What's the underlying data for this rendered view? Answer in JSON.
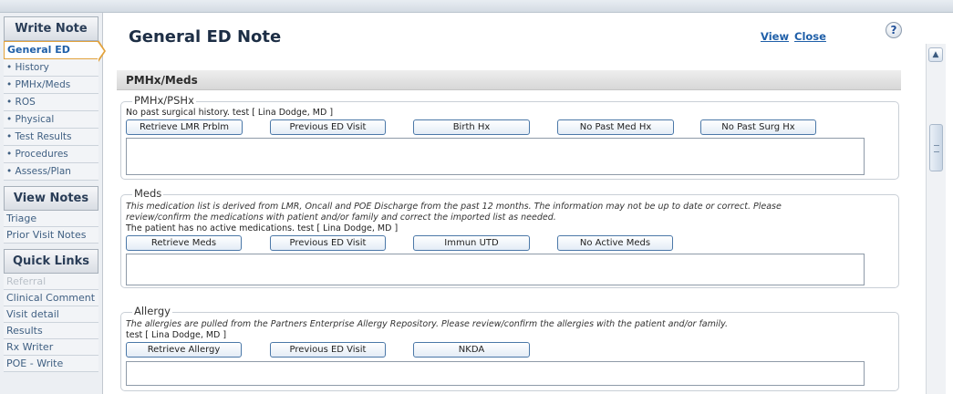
{
  "sidebar": {
    "write_note": {
      "heading": "Write Note",
      "active_item": "General ED",
      "items": [
        "History",
        "PMHx/Meds",
        "ROS",
        "Physical",
        "Test Results",
        "Procedures",
        "Assess/Plan"
      ]
    },
    "view_notes": {
      "heading": "View Notes",
      "items": [
        "Triage",
        "Prior Visit Notes"
      ]
    },
    "quick_links": {
      "heading": "Quick Links",
      "items": [
        "Referral",
        "Clinical Comment",
        "Visit detail",
        "Results",
        "Rx Writer",
        "POE - Write"
      ],
      "disabled_item": "Referral"
    }
  },
  "main": {
    "title": "General ED Note",
    "view_link": "View",
    "close_link": "Close",
    "help_icon": "?",
    "section_title": "PMHx/Meds",
    "pmhx": {
      "legend": "PMHx/PSHx",
      "info": "No past surgical history. test [ Lina Dodge, MD ]",
      "buttons": [
        "Retrieve LMR Prblm",
        "Previous ED Visit",
        "Birth Hx",
        "No Past Med Hx",
        "No Past Surg Hx"
      ]
    },
    "meds": {
      "legend": "Meds",
      "disclaimer_line1": "This medication list is derived from LMR, Oncall and POE Discharge from the past 12 months. The information may not be up to date or correct. Please",
      "disclaimer_line2": "review/confirm the medications with patient and/or family and correct the imported list as needed.",
      "info": "The patient has no active medications. test [ Lina Dodge, MD ]",
      "buttons": [
        "Retrieve Meds",
        "Previous ED Visit",
        "Immun UTD",
        "No Active Meds"
      ]
    },
    "allergy": {
      "legend": "Allergy",
      "disclaimer": "The allergies are pulled from the Partners Enterprise Allergy Repository. Please review/confirm the allergies with the patient and/or family.",
      "info": "test [ Lina Dodge, MD ]",
      "buttons": [
        "Retrieve Allergy",
        "Previous ED Visit",
        "NKDA"
      ]
    }
  },
  "scrollbar": {
    "up_icon": "chevron-up-icon"
  },
  "colors": {
    "link": "#1f5fa8",
    "active_tab_border": "#e2a23c",
    "button_border": "#4b78a8"
  }
}
